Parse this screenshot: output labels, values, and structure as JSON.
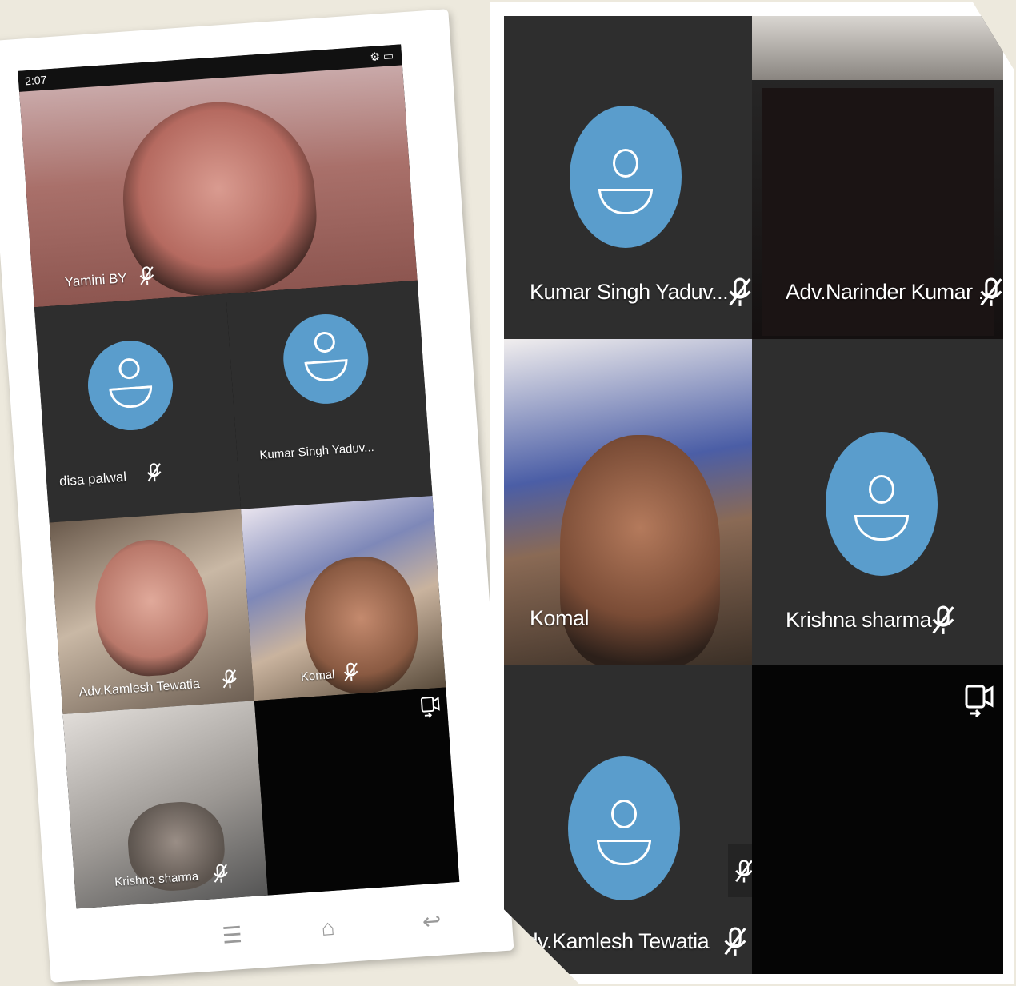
{
  "phone": {
    "status": {
      "time": "2:07",
      "system": "⚙ ▭"
    },
    "participants": [
      {
        "name": "Yamini BY",
        "muted": true,
        "video": true
      },
      {
        "name": "disa palwal",
        "muted": true,
        "video": false
      },
      {
        "name": "Kumar Singh Yaduv...",
        "muted": false,
        "video": false
      },
      {
        "name": "Adv.Kamlesh Tewatia",
        "muted": true,
        "video": true
      },
      {
        "name": "Komal",
        "muted": true,
        "video": true
      },
      {
        "name": "Krishna sharma",
        "muted": true,
        "video": true
      }
    ],
    "navbar": {
      "menu": "☰",
      "home": "⌂",
      "back": "↩"
    }
  },
  "panel": {
    "participants": [
      {
        "name": "Kumar Singh Yaduv...",
        "muted": true,
        "video": false
      },
      {
        "name": "Adv.Narinder Kumar ...",
        "muted": true,
        "video": true
      },
      {
        "name": "Komal",
        "muted": false,
        "video": true
      },
      {
        "name": "Krishna sharma",
        "muted": true,
        "video": false
      },
      {
        "name": "Adv.Kamlesh Tewatia",
        "muted": true,
        "video": false
      }
    ]
  },
  "colors": {
    "avatar": "#5a9dcc",
    "tile": "#2e2e2e",
    "background": "#ede9dd"
  }
}
